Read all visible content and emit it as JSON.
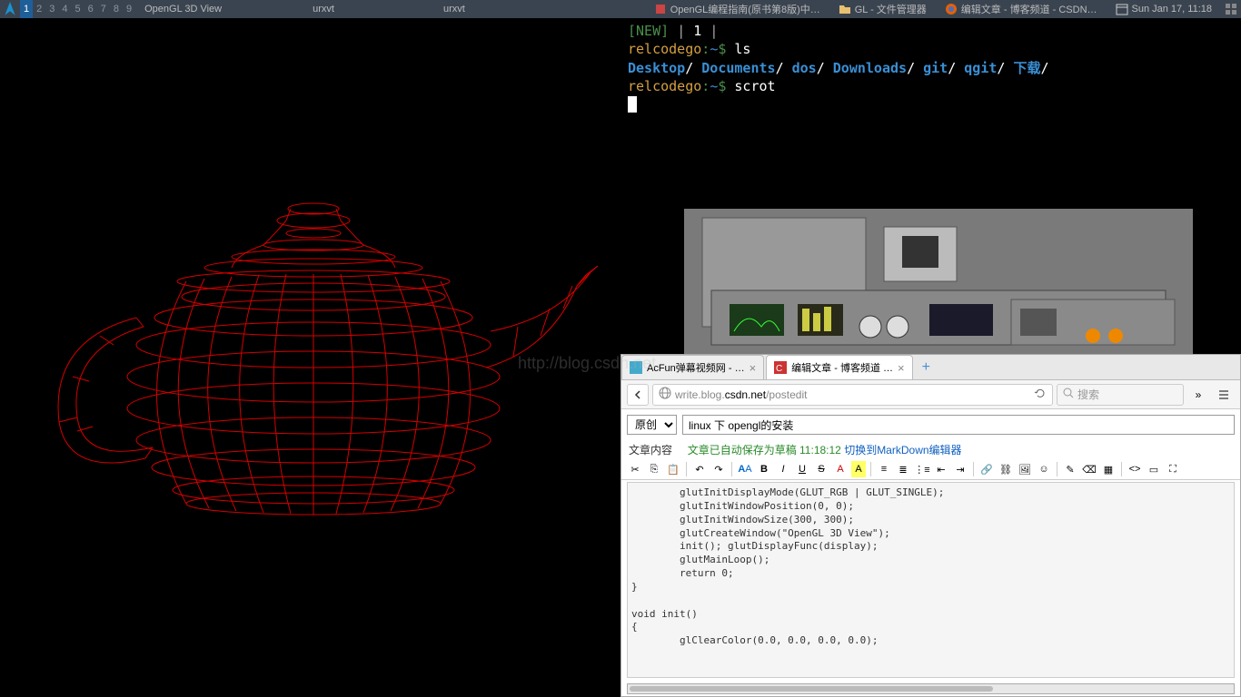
{
  "taskbar": {
    "workspaces": [
      "1",
      "2",
      "3",
      "4",
      "5",
      "6",
      "7",
      "8",
      "9"
    ],
    "active_ws": 0,
    "items": [
      {
        "label": "OpenGL 3D View"
      },
      {
        "label": "urxvt"
      },
      {
        "label": "urxvt"
      },
      {
        "label": "OpenGL编程指南(原书第8版)中…"
      },
      {
        "label": "GL - 文件管理器"
      },
      {
        "label": "编辑文章 - 博客频道 - CSDN…"
      }
    ],
    "clock": "Sun Jan 17, 11:18"
  },
  "terminal": {
    "status": "[NEW]",
    "status_num": "1",
    "user": "relcodego",
    "host": "",
    "path": "~",
    "prompt": "$",
    "cmd1": "ls",
    "dirs": [
      "Desktop",
      "Documents",
      "dos",
      "Downloads",
      "git",
      "qgit",
      "下载"
    ],
    "cmd2": "scrot"
  },
  "browser": {
    "tabs": [
      {
        "title": "AcFun弹幕视频网 - …",
        "active": false
      },
      {
        "title": "编辑文章 - 博客频道 …",
        "active": true
      }
    ],
    "url_prefix": "write.blog.",
    "url_domain": "csdn.net",
    "url_path": "/postedit",
    "search_placeholder": "搜索",
    "chevron": "»"
  },
  "editor": {
    "category": "原创",
    "title": "linux 下 opengl的安装",
    "content_label": "文章内容",
    "autosave": "文章已自动保存为草稿 11:18:12",
    "markdown_link": "切换到MarkDown编辑器",
    "code": "        glutInitDisplayMode(GLUT_RGB | GLUT_SINGLE);\n        glutInitWindowPosition(0, 0);\n        glutInitWindowSize(300, 300);\n        glutCreateWindow(\"OpenGL 3D View\");\n        init(); glutDisplayFunc(display);\n        glutMainLoop();\n        return 0;\n}\n\nvoid init()\n{\n        glClearColor(0.0, 0.0, 0.0, 0.0);"
  },
  "watermark": "http://blog.csdn.net"
}
